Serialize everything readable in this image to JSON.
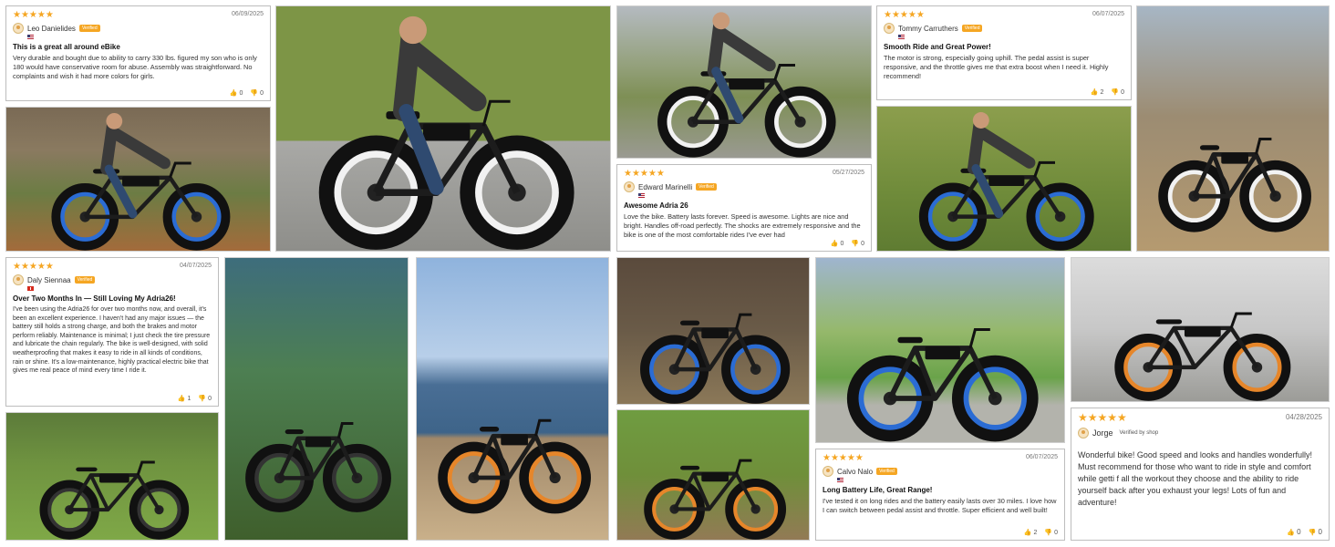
{
  "reviews": [
    {
      "stars": "★★★★★",
      "date": "06/09/2025",
      "name": "Leo Danielides",
      "badge": "Verified",
      "title": "This is a great all around eBike",
      "body": "Very durable and bought due to ability to carry 330 lbs. figured my son who is only 180 would have conservative room for abuse. Assembly was straightforward. No complaints and wish it had more colors for girls.",
      "up": "0",
      "down": "0"
    },
    {
      "stars": "★★★★★",
      "date": "05/27/2025",
      "name": "Edward Marinelli",
      "badge": "Verified",
      "title": "Awesome Adria 26",
      "body": "Love the bike. Battery lasts forever. Speed is awesome. Lights are nice and bright. Handles off-road perfectly. The shocks are extremely responsive and the bike is one of the most comfortable rides I've ever had",
      "up": "0",
      "down": "0"
    },
    {
      "stars": "★★★★★",
      "date": "06/07/2025",
      "name": "Tommy Carruthers",
      "badge": "Verified",
      "title": "Smooth Ride and Great Power!",
      "body": "The motor is strong, especially going uphill. The pedal assist is super responsive, and the throttle gives me that extra boost when I need it. Highly recommend!",
      "up": "2",
      "down": "0"
    },
    {
      "stars": "★★★★★",
      "date": "04/07/2025",
      "name": "Daly Siennaa",
      "badge": "Verified",
      "title": "Over Two Months In — Still Loving My Adria26!",
      "body": "I've been using the Adria26 for over two months now, and overall, it's been an excellent experience. I haven't had any major issues — the battery still holds a strong charge, and both the brakes and motor perform reliably. Maintenance is minimal; I just check the tire pressure and lubricate the chain regularly. The bike is well-designed, with solid weatherproofing that makes it easy to ride in all kinds of conditions, rain or shine. It's a low-maintenance, highly practical electric bike that gives me real peace of mind every time I ride it.",
      "up": "1",
      "down": "0"
    },
    {
      "stars": "★★★★★",
      "date": "06/07/2025",
      "name": "Calvo Nalo",
      "badge": "Verified",
      "title": "Long Battery Life, Great Range!",
      "body": "I've tested it on long rides and the battery easily lasts over 30 miles. I love how I can switch between pedal assist and throttle. Super efficient and well built!",
      "up": "2",
      "down": "0"
    },
    {
      "stars": "★★★★★",
      "date": "04/28/2025",
      "name": "Jorge",
      "badge": "Verified by shop",
      "title": "",
      "body": "Wonderful bike! Good speed and looks and handles wonderfully! Must recommend for those who want to ride in style and comfort while getti f all the workout they choose and the ability to ride yourself back after you exhaust your legs! Lots of fun and adventure!",
      "up": "0",
      "down": "0"
    }
  ],
  "colors": {
    "star": "#f5a623",
    "rim_blue": "#2b6cd4",
    "rim_orange": "#e6862a",
    "tire_white": "#f2f2f2",
    "frame": "#1c1c1c"
  },
  "photos": [
    {
      "scene": "forest",
      "rim": "blue",
      "rider": true
    },
    {
      "scene": "driveway",
      "rim": "white",
      "rider": true
    },
    {
      "scene": "yard",
      "rim": "white",
      "rider": true
    },
    {
      "scene": "lawn",
      "rim": "blue",
      "rider": true
    },
    {
      "scene": "dirt",
      "rim": "white",
      "rider": false
    },
    {
      "scene": "woods",
      "rim": "black",
      "rider": false
    },
    {
      "scene": "foliage",
      "rim": "black",
      "rider": false
    },
    {
      "scene": "lake",
      "rim": "orange",
      "rider": false
    },
    {
      "scene": "rock",
      "rim": "blue",
      "rider": false
    },
    {
      "scene": "field",
      "rim": "orange",
      "rider": false
    },
    {
      "scene": "playground",
      "rim": "blue",
      "rider": false
    },
    {
      "scene": "garage",
      "rim": "orange",
      "rider": false
    }
  ]
}
